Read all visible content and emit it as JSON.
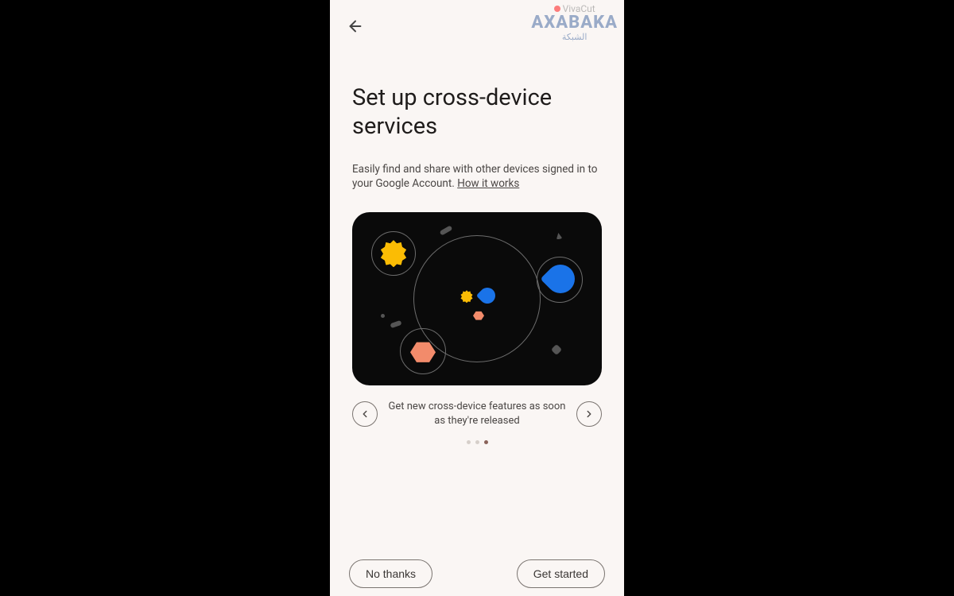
{
  "watermark": {
    "line1": "VivaCut",
    "line2": "AXABAKA",
    "line3": "الشبكة"
  },
  "header": {
    "title": "Set up cross-device services"
  },
  "description": {
    "text": "Easily find and share with other devices signed in to your Google Account. ",
    "link_text": "How it works"
  },
  "carousel": {
    "caption": "Get new cross-device features as soon as they're released",
    "active_index": 2,
    "total": 3
  },
  "footer": {
    "decline_label": "No thanks",
    "accept_label": "Get started"
  }
}
